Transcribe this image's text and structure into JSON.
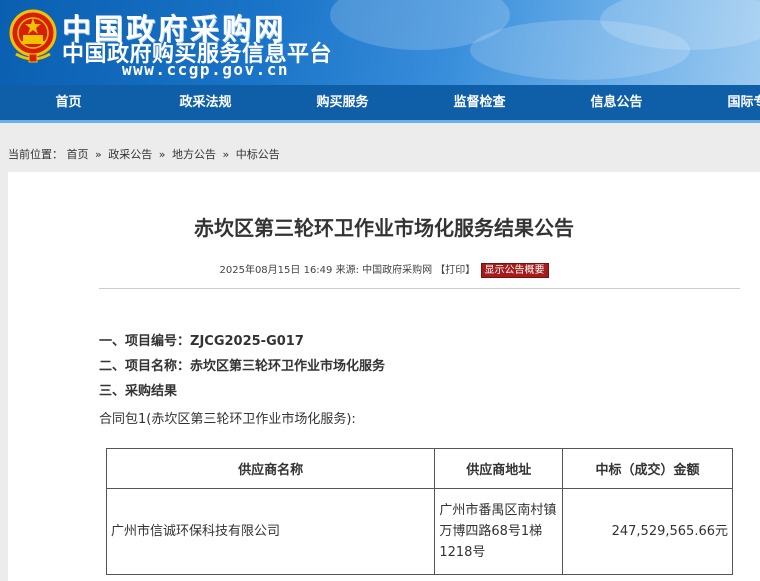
{
  "header": {
    "site_name": "中国政府采购网",
    "subtitle": "中国政府购买服务信息平台",
    "url": "www.ccgp.gov.cn"
  },
  "nav": {
    "items": [
      {
        "label": "首页"
      },
      {
        "label": "政采法规"
      },
      {
        "label": "购买服务"
      },
      {
        "label": "监督检查"
      },
      {
        "label": "信息公告"
      },
      {
        "label": "国际专栏"
      }
    ]
  },
  "breadcrumb": {
    "prefix": "当前位置：",
    "items": [
      "首页",
      "政采公告",
      "地方公告",
      "中标公告"
    ],
    "sep": "»"
  },
  "article": {
    "title": "赤坎区第三轮环卫作业市场化服务结果公告",
    "meta_text": "2025年08月15日 16:49 来源: 中国政府采购网 【打印】",
    "badge": "显示公告概要",
    "item1_label": "一、项目编号：",
    "item1_value": "ZJCG2025-G017",
    "item2_label": "二、项目名称：",
    "item2_value": "赤坎区第三轮环卫作业市场化服务",
    "item3": "三、采购结果",
    "package": "合同包1(赤坎区第三轮环卫作业市场化服务):"
  },
  "table": {
    "headers": [
      "供应商名称",
      "供应商地址",
      "中标（成交）金额"
    ],
    "rows": [
      {
        "supplier": "广州市信诚环保科技有限公司",
        "address": "广州市番禺区南村镇万博四路68号1梯1218号",
        "amount": "247,529,565.66元"
      }
    ]
  },
  "colors": {
    "nav_bg": "#0f5fa8",
    "badge_bg": "#a41c1c"
  }
}
